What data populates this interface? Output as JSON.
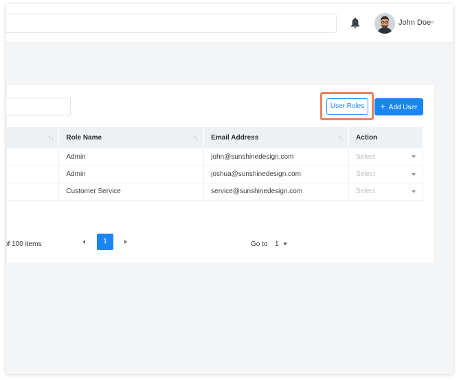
{
  "header": {
    "user_name": "John Doe"
  },
  "toolbar": {
    "user_roles_label": "User Roles",
    "add_user_label": "Add User"
  },
  "table": {
    "columns": [
      "",
      "Role Name",
      "Email Address",
      "Action"
    ],
    "rows": [
      {
        "role": "Admin",
        "email": "john@sunshinedesign.com",
        "action": "Select"
      },
      {
        "role": "Admin",
        "email": "joshua@sunshinedesign.com",
        "action": "Select"
      },
      {
        "role": "Customer Service",
        "email": "service@sunshinedesign.com",
        "action": "Select"
      }
    ]
  },
  "pagination": {
    "items_text": "of 100 items",
    "current_page": "1",
    "goto_label": "Go to",
    "goto_value": "1"
  },
  "colors": {
    "accent": "#1a86f5",
    "highlight": "#e8825f"
  }
}
